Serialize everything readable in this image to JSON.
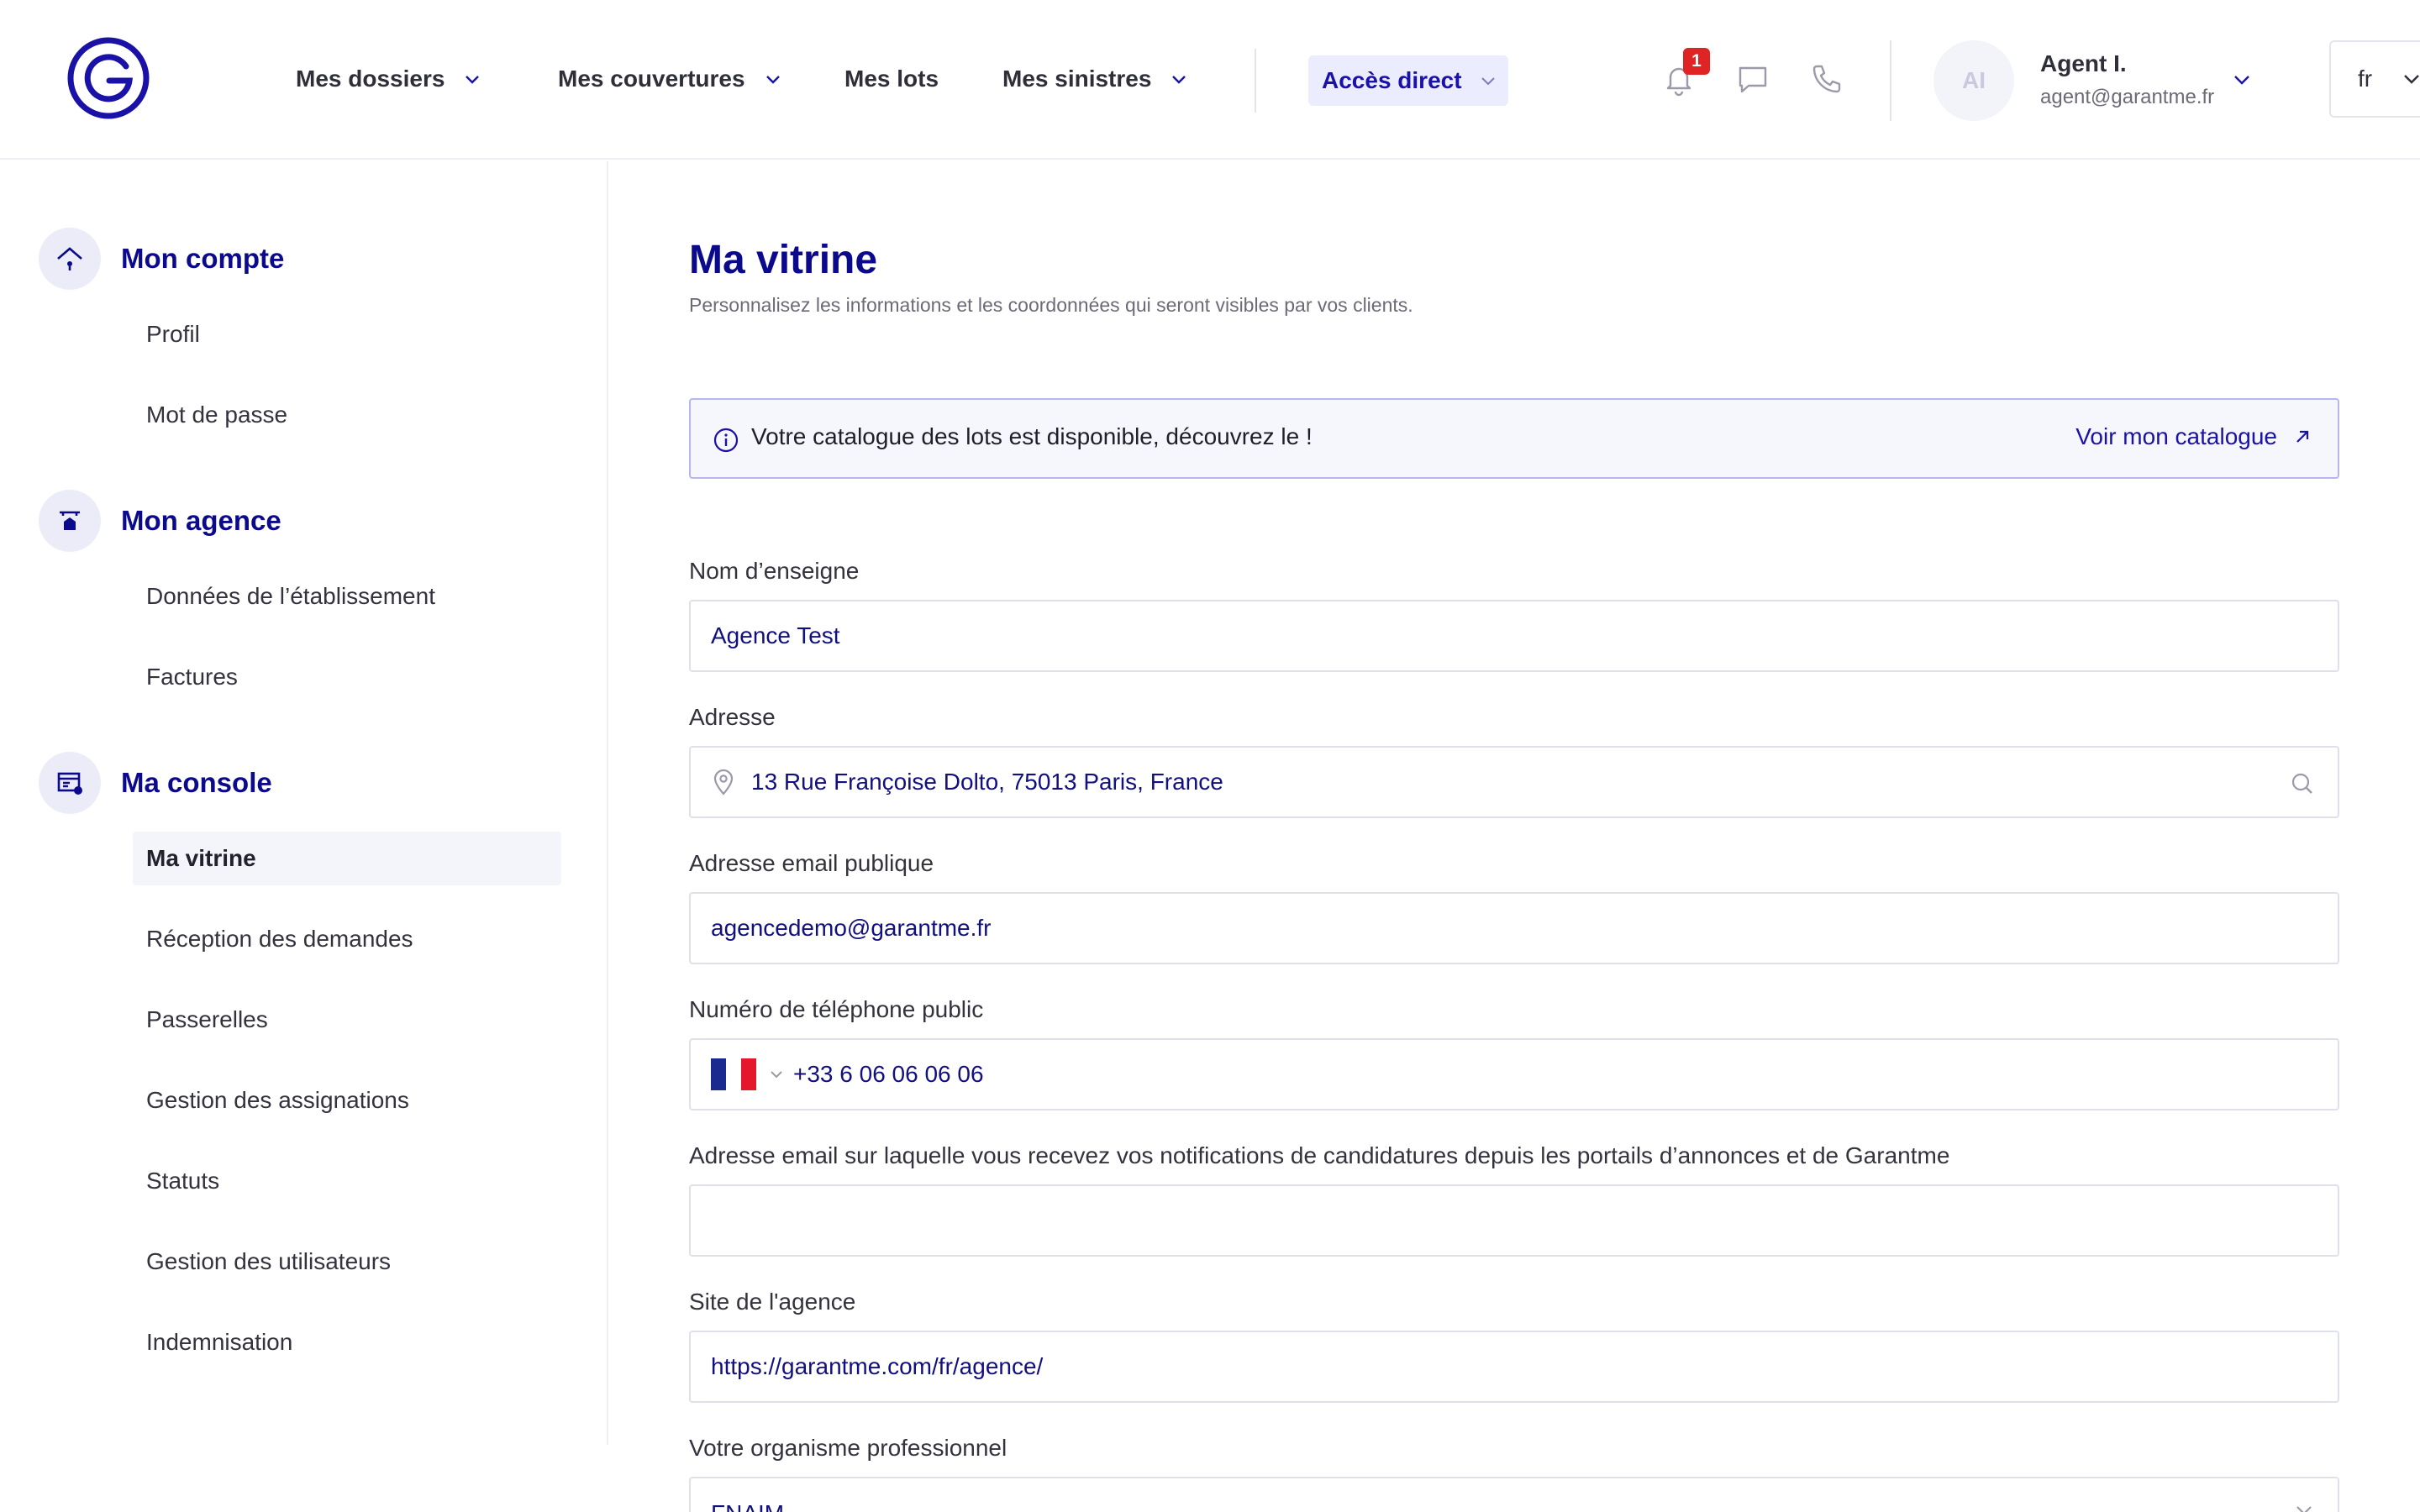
{
  "header": {
    "nav": [
      {
        "label": "Mes dossiers",
        "has_menu": true
      },
      {
        "label": "Mes couvertures",
        "has_menu": true
      },
      {
        "label": "Mes lots",
        "has_menu": false
      },
      {
        "label": "Mes sinistres",
        "has_menu": true
      }
    ],
    "acces_direct": "Accès direct",
    "notification_count": "1",
    "icons": [
      "bell-icon",
      "chat-icon",
      "phone-icon"
    ],
    "user": {
      "initials": "AI",
      "name": "Agent I.",
      "email": "agent@garantme.fr"
    },
    "language": "fr"
  },
  "sidebar": {
    "sections": [
      {
        "title": "Mon compte",
        "icon": "account-icon",
        "items": [
          "Profil",
          "Mot de passe"
        ]
      },
      {
        "title": "Mon agence",
        "icon": "agency-icon",
        "items": [
          "Données de l’établissement",
          "Factures"
        ]
      },
      {
        "title": "Ma console",
        "icon": "console-icon",
        "items": [
          "Ma vitrine",
          "Réception des demandes",
          "Passerelles",
          "Gestion des assignations",
          "Statuts",
          "Gestion des utilisateurs",
          "Indemnisation"
        ]
      }
    ],
    "active_item": "Ma vitrine"
  },
  "main": {
    "title": "Ma vitrine",
    "subtitle": "Personnalisez les informations et les coordonnées qui seront visibles par vos clients.",
    "banner": {
      "text": "Votre catalogue des lots est disponible, découvrez le !",
      "link": "Voir mon catalogue"
    },
    "fields": {
      "nom": {
        "label": "Nom d’enseigne",
        "value": "Agence Test"
      },
      "adresse": {
        "label": "Adresse",
        "value": "13 Rue Françoise Dolto, 75013 Paris, France"
      },
      "email_public": {
        "label": "Adresse email publique",
        "value": "agencedemo@garantme.fr"
      },
      "telephone": {
        "label": "Numéro de téléphone public",
        "value": "+33 6 06 06 06 06",
        "country": "FR"
      },
      "email_notif": {
        "label": "Adresse email sur laquelle vous recevez vos notifications de candidatures depuis les portails d’annonces et de Garantme",
        "value": ""
      },
      "site": {
        "label": "Site de l'agence",
        "value": "https://garantme.com/fr/agence/"
      },
      "organisme": {
        "label": "Votre organisme professionnel",
        "value": "FNAIM"
      }
    }
  },
  "colors": {
    "brand": "#1a12a6",
    "title": "#0c0a8c",
    "badge": "#e02424",
    "banner_bg": "#f6f6fd"
  }
}
